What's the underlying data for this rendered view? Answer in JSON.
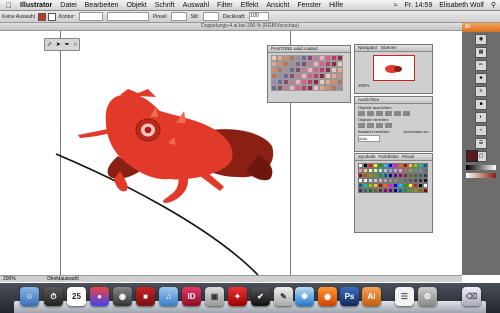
{
  "menubar": {
    "apple": "",
    "app": "Illustrator",
    "items": [
      "Datei",
      "Bearbeiten",
      "Objekt",
      "Schrift",
      "Auswahl",
      "Filter",
      "Effekt",
      "Ansicht",
      "Fenster",
      "Hilfe"
    ],
    "clock": "Fr. 14:59",
    "user": "Elisabeth Wolf"
  },
  "control": {
    "selection": "Keine Auswahl",
    "stroke_label": "Kontur:",
    "pt_label": "Pinsel",
    "style_label": "Stil:",
    "opacity_label": "Deckkraft:",
    "opacity_value": "100"
  },
  "document": {
    "title": "Doppelungs-4.ai bei 200 % (RGB/Vorschau)"
  },
  "panels": {
    "pantone": {
      "tab": "PANTONE solid coated"
    },
    "navigator": {
      "tabs": [
        "Navigator",
        "Ebenen"
      ],
      "zoom": "200%"
    },
    "align": {
      "tabs": [
        "Ausrichten"
      ],
      "section1": "Objekte ausrichten:",
      "section2": "Objekte verteilen:",
      "section3": "Abstand verteilen:",
      "section4": "Ausrichten an:",
      "value": "Auto"
    },
    "swatches": {
      "tabs": [
        "Symbole",
        "Farbfelder",
        "Pinsel"
      ]
    }
  },
  "statusbar": {
    "zoom": "200%",
    "tool": "Direktauswahl"
  },
  "dock": {
    "calendar_day": "25",
    "apps": [
      "Finder",
      "Dashboard",
      "iCal",
      "Colors",
      "Photo",
      "Lexikon",
      "iTunes",
      "ID",
      "Vorschau",
      "Acrobat",
      "Code",
      "Textedit",
      "Safari",
      "Firefox",
      "Ps",
      "Ai",
      "Notes",
      "Utility",
      "Papierkorb"
    ]
  },
  "colors": {
    "accent": "#e07a2a",
    "frog": "#e23a2a",
    "frog_dark": "#8a1f14"
  }
}
